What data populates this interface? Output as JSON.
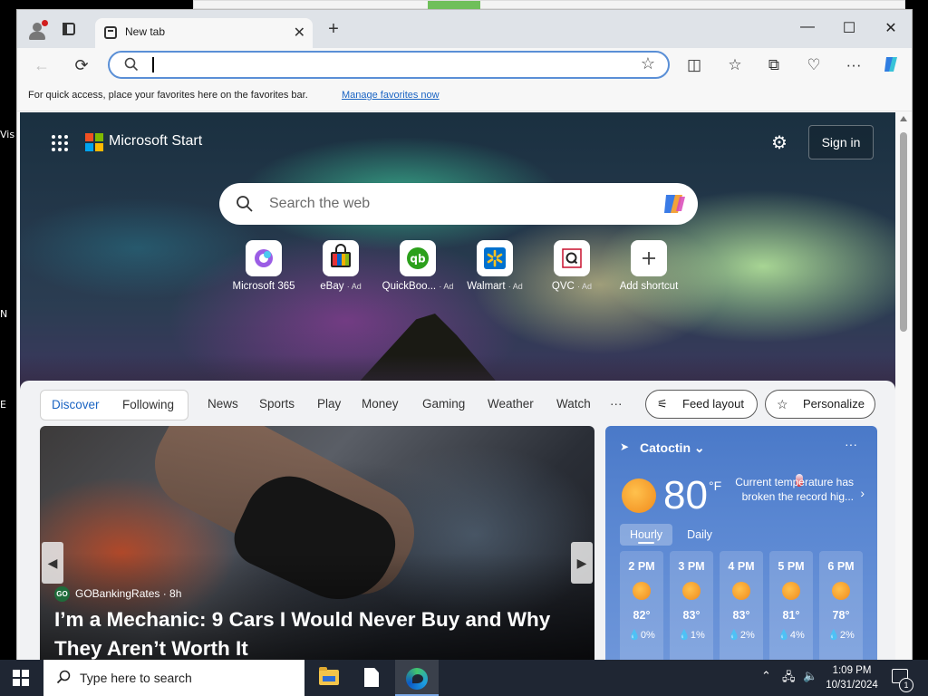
{
  "desktop": {
    "edge_labels": [
      "Vis",
      "N",
      "E"
    ]
  },
  "browser": {
    "tab": {
      "title": "New tab"
    },
    "new_tab_symbol": "+",
    "window_controls": {
      "minimize": "—",
      "maximize": "☐",
      "close": "✕"
    },
    "address": {
      "value": ""
    },
    "favorites_bar": {
      "message": "For quick access, place your favorites here on the favorites bar.",
      "link": "Manage favorites now"
    }
  },
  "start_page": {
    "brand": "Microsoft Start",
    "sign_in": "Sign in",
    "search_placeholder": "Search the web",
    "shortcuts": [
      {
        "label": "Microsoft 365",
        "ad": "",
        "icon": "m365-icon"
      },
      {
        "label": "eBay",
        "ad": "· Ad",
        "icon": "ebay-icon"
      },
      {
        "label": "QuickBoo...",
        "ad": "· Ad",
        "icon": "quickbooks-icon"
      },
      {
        "label": "Walmart",
        "ad": "· Ad",
        "icon": "walmart-icon"
      },
      {
        "label": "QVC",
        "ad": "· Ad",
        "icon": "qvc-icon"
      },
      {
        "label": "Add shortcut",
        "ad": "",
        "icon": "plus-icon"
      }
    ],
    "feed_tabs": {
      "discover": "Discover",
      "following": "Following",
      "links": [
        "News",
        "Sports",
        "Play",
        "Money",
        "Gaming",
        "Weather",
        "Watch"
      ],
      "more": "···",
      "feed_layout": "Feed layout",
      "personalize": "Personalize"
    },
    "article": {
      "source_badge": "GO",
      "source": "GOBankingRates · 8h",
      "headline": "I’m a Mechanic: 9 Cars I Would Never Buy and Why They Aren’t Worth It"
    },
    "weather": {
      "location": "Catoctin",
      "temperature": "80",
      "unit": "°F",
      "alert": "Current temperature has broken the record hig...",
      "tabs": {
        "hourly": "Hourly",
        "daily": "Daily"
      },
      "hours": [
        {
          "time": "2 PM",
          "temp": "82°",
          "precip": "💧0%"
        },
        {
          "time": "3 PM",
          "temp": "83°",
          "precip": "💧1%"
        },
        {
          "time": "4 PM",
          "temp": "83°",
          "precip": "💧2%"
        },
        {
          "time": "5 PM",
          "temp": "81°",
          "precip": "💧4%"
        },
        {
          "time": "6 PM",
          "temp": "78°",
          "precip": "💧2%"
        }
      ]
    }
  },
  "taskbar": {
    "search_placeholder": "Type here to search",
    "time": "1:09 PM",
    "date": "10/31/2024",
    "notification_count": "1"
  },
  "colors": {
    "accent": "#1a64c3",
    "address_border": "#5a8fd6",
    "taskbar": "#1f2633",
    "weather_card": "#5a87d2"
  }
}
